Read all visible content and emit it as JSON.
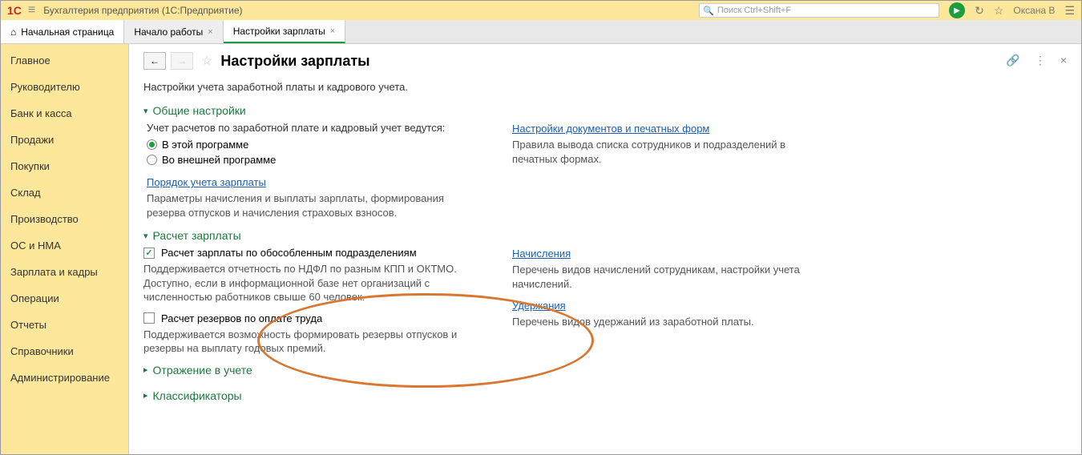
{
  "titlebar": {
    "app_title": "Бухгалтерия предприятия  (1С:Предприятие)",
    "search_placeholder": "Поиск Ctrl+Shift+F",
    "username": "Оксана В"
  },
  "tabs": {
    "home": "Начальная страница",
    "t1": "Начало работы",
    "t2": "Настройки зарплаты"
  },
  "sidebar": {
    "items": [
      "Главное",
      "Руководителю",
      "Банк и касса",
      "Продажи",
      "Покупки",
      "Склад",
      "Производство",
      "ОС и НМА",
      "Зарплата и кадры",
      "Операции",
      "Отчеты",
      "Справочники",
      "Администрирование"
    ]
  },
  "page": {
    "title": "Настройки зарплаты",
    "subtitle": "Настройки учета заработной платы и кадрового учета."
  },
  "s_general": {
    "header": "Общие настройки",
    "lead": "Учет расчетов по заработной плате и кадровый учет ведутся:",
    "opt1": "В этой программе",
    "opt2": "Во внешней программе",
    "link_order": "Порядок учета зарплаты",
    "desc_order": "Параметры начисления и выплаты зарплаты, формирования резерва отпусков и начисления страховых взносов.",
    "link_docs": "Настройки документов и печатных форм",
    "desc_docs": "Правила вывода списка сотрудников и подразделений в печатных формах."
  },
  "s_salary": {
    "header": "Расчет зарплаты",
    "chk1": "Расчет зарплаты по обособленным подразделениям",
    "desc1": "Поддерживается отчетность по НДФЛ по разным КПП и ОКТМО. Доступно, если в информационной базе нет организаций с численностью работников свыше 60 человек.",
    "chk2": "Расчет резервов по оплате труда",
    "desc2": "Поддерживается возможность формировать резервы отпусков и резервы на выплату годовых премий.",
    "link_accrual": "Начисления",
    "desc_accrual": "Перечень видов начислений сотрудникам, настройки учета начислений.",
    "link_deduct": "Удержания",
    "desc_deduct": "Перечень видов удержаний из заработной платы."
  },
  "s_reflect": {
    "header": "Отражение в учете"
  },
  "s_class": {
    "header": "Классификаторы"
  }
}
